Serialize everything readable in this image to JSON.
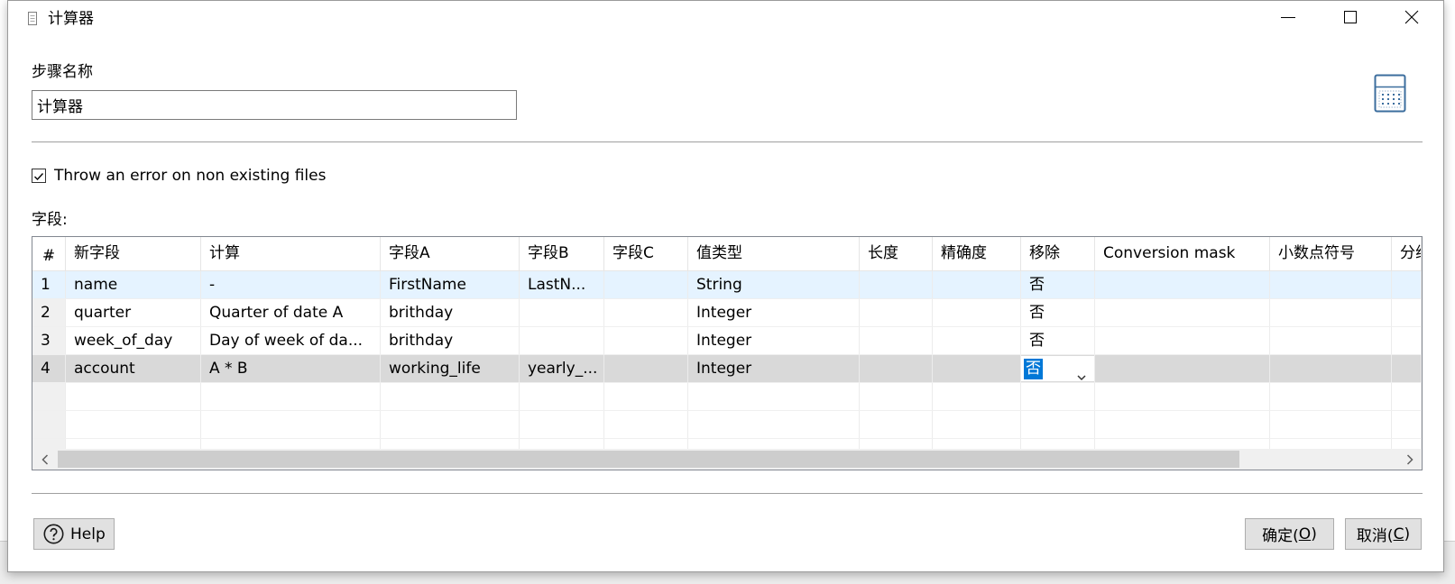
{
  "window": {
    "title": "计算器",
    "title_icon": "document-icon",
    "controls": [
      "minimize-icon",
      "maximize-icon",
      "close-icon"
    ]
  },
  "step_name": {
    "label": "步骤名称",
    "value": "计算器"
  },
  "step_icon": "calculator-icon",
  "throw_error": {
    "label": "Throw an error on non existing files",
    "checked": true
  },
  "fields": {
    "label": "字段:",
    "sort_icon": "sort-ascending-icon",
    "columns": [
      "#",
      "新字段",
      "计算",
      "字段A",
      "字段B",
      "字段C",
      "值类型",
      "长度",
      "精确度",
      "移除",
      "Conversion mask",
      "小数点符号",
      "分组"
    ],
    "rows": [
      {
        "state": "highlighted",
        "cells": [
          "1",
          "name",
          "-",
          "FirstName",
          "LastN...",
          "",
          "String",
          "",
          "",
          "否",
          "",
          "",
          ""
        ]
      },
      {
        "state": "normal",
        "cells": [
          "2",
          "quarter",
          "Quarter of date A",
          "brithday",
          "",
          "",
          "Integer",
          "",
          "",
          "否",
          "",
          "",
          ""
        ]
      },
      {
        "state": "normal",
        "cells": [
          "3",
          "week_of_day",
          "Day of week of da...",
          "brithday",
          "",
          "",
          "Integer",
          "",
          "",
          "否",
          "",
          "",
          ""
        ]
      },
      {
        "state": "selected",
        "editing": "移除",
        "cells": [
          "4",
          "account",
          "A * B",
          "working_life",
          "yearly_...",
          "",
          "Integer",
          "",
          "",
          "否",
          "",
          "",
          ""
        ]
      }
    ]
  },
  "buttons": {
    "help": {
      "label": "Help",
      "icon": "help-icon"
    },
    "ok": {
      "text_before": "确定(",
      "mnemonic": "O",
      "text_after": ")"
    },
    "cancel": {
      "text_before": "取消(",
      "mnemonic": "C",
      "text_after": ")"
    }
  },
  "colors": {
    "row_highlight": "#e5f3ff",
    "row_selected": "#d9d9d9",
    "text_selection": "#0078d7",
    "icon_accent": "#3c6e9e"
  }
}
